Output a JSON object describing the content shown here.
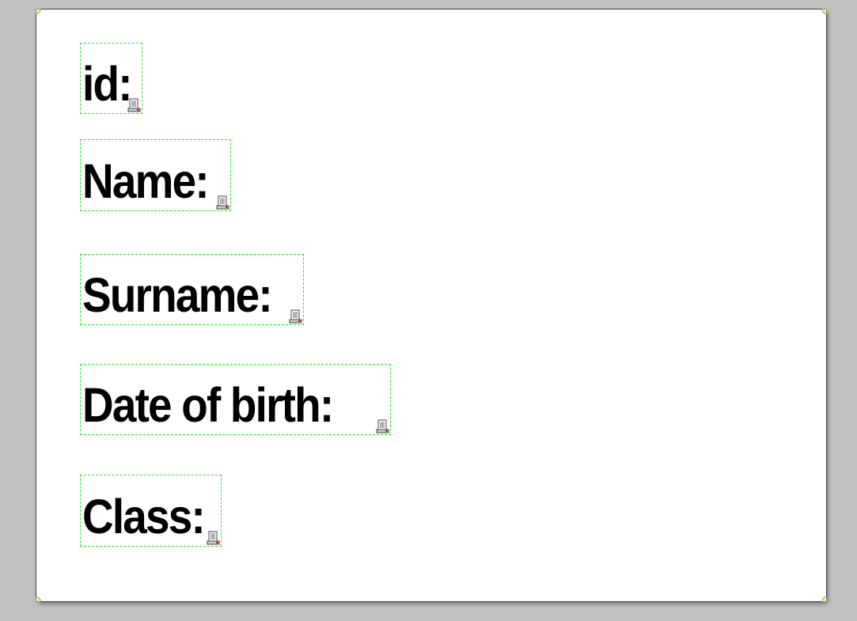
{
  "form": {
    "labels": [
      {
        "text": "id:"
      },
      {
        "text": "Name:"
      },
      {
        "text": "Surname:"
      },
      {
        "text": "Date of birth:"
      },
      {
        "text": "Class:"
      }
    ]
  },
  "icons": {
    "field_icon": "text-field-icon"
  },
  "colors": {
    "workspace_bg": "#c0c0c0",
    "page_bg": "#ffffff",
    "selection_border": "#33dd33",
    "label_text": "#000000",
    "icon_marker": "#e02020"
  }
}
